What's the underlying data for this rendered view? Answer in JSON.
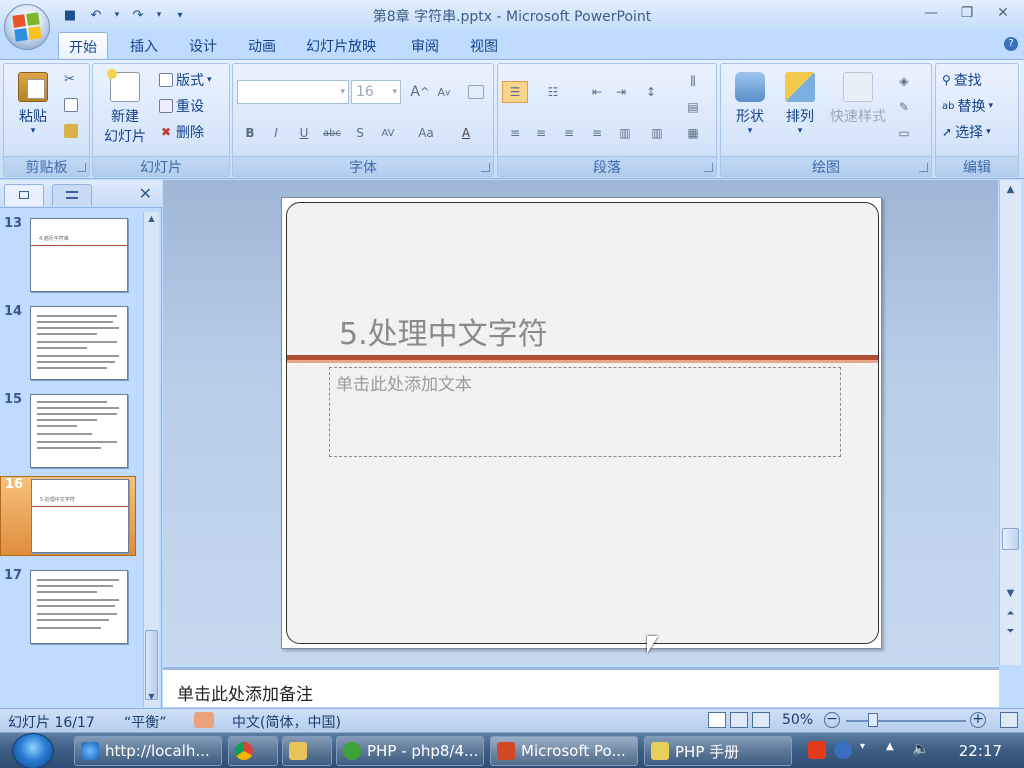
{
  "window": {
    "title": "第8章 字符串.pptx - Microsoft PowerPoint"
  },
  "qat": {
    "save_icon": "save-icon",
    "undo_icon": "undo-icon",
    "redo_icon": "redo-icon"
  },
  "tabs": [
    {
      "label": "开始",
      "active": true
    },
    {
      "label": "插入"
    },
    {
      "label": "设计"
    },
    {
      "label": "动画"
    },
    {
      "label": "幻灯片放映"
    },
    {
      "label": "审阅"
    },
    {
      "label": "视图"
    }
  ],
  "ribbon": {
    "clipboard": {
      "label": "剪贴板",
      "paste": "粘贴"
    },
    "slides": {
      "label": "幻灯片",
      "new_slide_line1": "新建",
      "new_slide_line2": "幻灯片",
      "layout": "版式",
      "reset": "重设",
      "delete": "删除"
    },
    "font": {
      "label": "字体",
      "size": "16",
      "bold": "B",
      "italic": "I",
      "underline": "U",
      "strike": "abc",
      "shadow": "S",
      "spacing": "AV",
      "case": "Aa",
      "color": "A",
      "grow": "A",
      "shrink": "A"
    },
    "paragraph": {
      "label": "段落"
    },
    "drawing": {
      "label": "绘图",
      "shapes": "形状",
      "arrange": "排列",
      "quick_styles": "快速样式"
    },
    "editing": {
      "label": "编辑",
      "find": "查找",
      "replace": "替换",
      "select": "选择"
    }
  },
  "slide_pane": {
    "thumbnails": [
      {
        "num": "13",
        "caption": "4.遍历字符串"
      },
      {
        "num": "14"
      },
      {
        "num": "15"
      },
      {
        "num": "16",
        "caption": "5.处理中文字符",
        "selected": true
      },
      {
        "num": "17"
      }
    ]
  },
  "slide": {
    "title": "5.处理中文字符",
    "body_placeholder": "单击此处添加文本"
  },
  "notes": {
    "placeholder": "单击此处添加备注"
  },
  "status": {
    "slide_info": "幻灯片 16/17",
    "theme": "“平衡”",
    "language": "中文(简体，中国)",
    "zoom": "50%"
  },
  "taskbar": {
    "items": [
      {
        "label": "http://localh..."
      },
      {
        "label": ""
      },
      {
        "label": ""
      },
      {
        "label": "PHP - php8/4..."
      },
      {
        "label": "Microsoft Po...",
        "active": true
      },
      {
        "label": "PHP 手册"
      }
    ],
    "clock": "22:17"
  },
  "colors": {
    "accent_bar": "#b14e32",
    "ribbon_bg": "#dbe8fb",
    "selected_thumb": "#e08d3c"
  }
}
